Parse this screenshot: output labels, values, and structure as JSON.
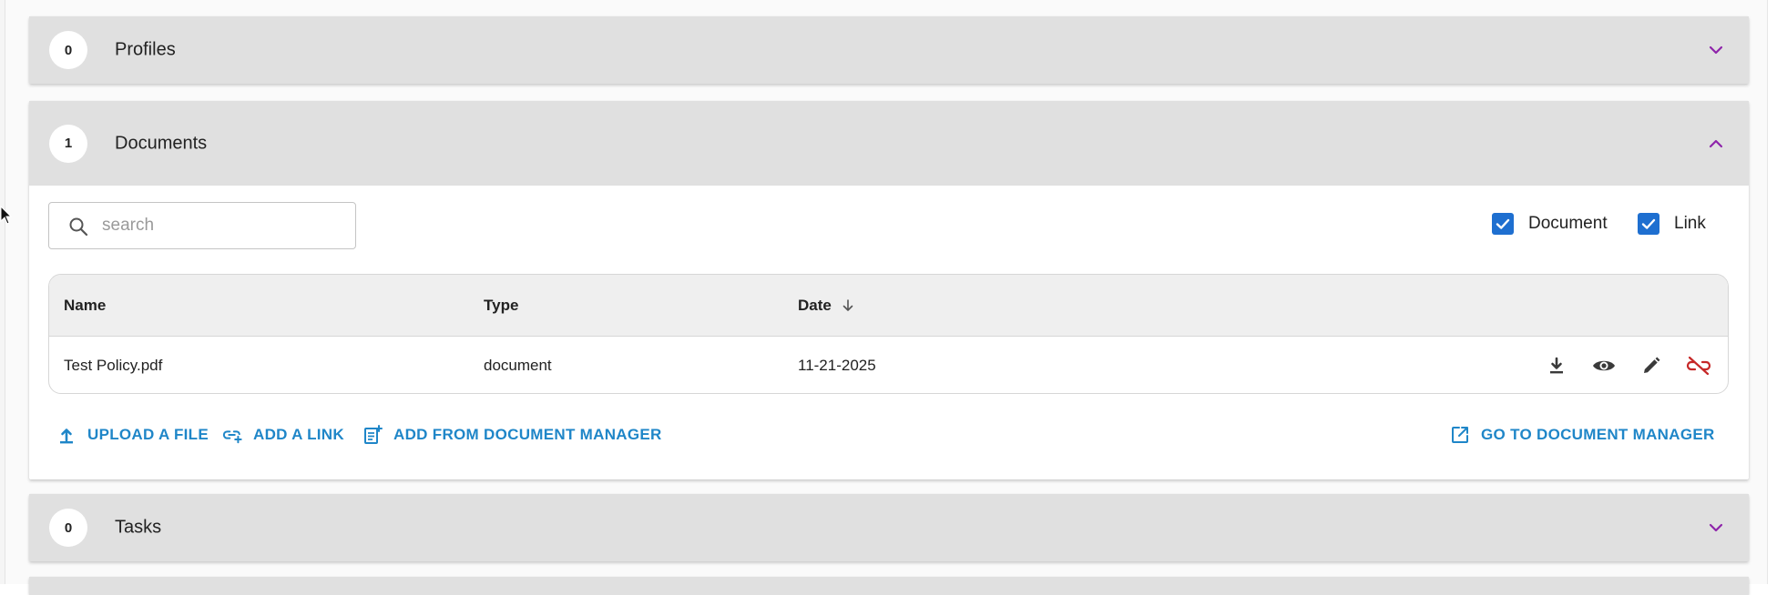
{
  "panels": {
    "profiles": {
      "count": "0",
      "title": "Profiles",
      "expanded": false
    },
    "documents": {
      "count": "1",
      "title": "Documents",
      "expanded": true
    },
    "tasks": {
      "count": "0",
      "title": "Tasks",
      "expanded": false
    }
  },
  "documents": {
    "search": {
      "placeholder": "search",
      "value": ""
    },
    "filters": [
      {
        "label": "Document",
        "checked": true
      },
      {
        "label": "Link",
        "checked": true
      }
    ],
    "table": {
      "columns": [
        "Name",
        "Type",
        "Date"
      ],
      "sort": {
        "column": "Date",
        "direction": "descending"
      },
      "rows": [
        {
          "name": "Test Policy.pdf",
          "type": "document",
          "date": "11-21-2025"
        }
      ],
      "row_actions": [
        "download-icon",
        "view-icon",
        "edit-icon",
        "unlink-icon"
      ]
    },
    "actions": {
      "upload": "UPLOAD A FILE",
      "add_link": "ADD A LINK",
      "add_from_manager": "ADD FROM DOCUMENT MANAGER",
      "go_to_manager": "GO TO DOCUMENT MANAGER"
    }
  },
  "colors": {
    "accent": "#1f86c8",
    "checkbox": "#1e6fd0",
    "chevron": "#8e24aa",
    "unlink": "#c62828",
    "header_bg": "#e0e0e0"
  }
}
